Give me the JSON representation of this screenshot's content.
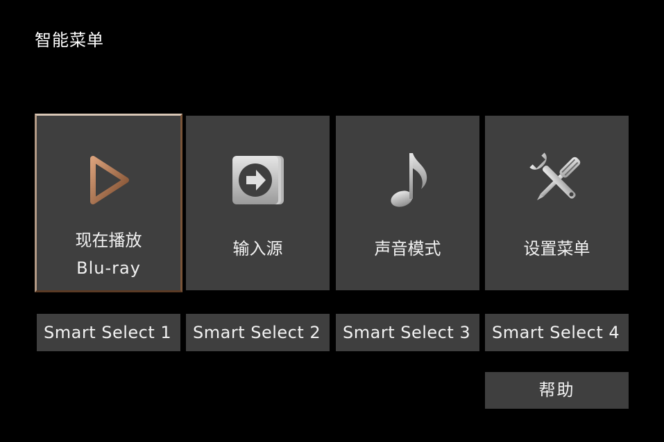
{
  "menu": {
    "title": "智能菜单"
  },
  "tiles": [
    {
      "label": "现在播放",
      "sublabel": "Blu-ray",
      "icon": "play-icon",
      "selected": true
    },
    {
      "label": "输入源",
      "icon": "input-source-icon",
      "selected": false
    },
    {
      "label": "声音模式",
      "icon": "music-note-icon",
      "selected": false
    },
    {
      "label": "设置菜单",
      "icon": "tools-icon",
      "selected": false
    }
  ],
  "smart_select": [
    {
      "label": "Smart Select 1"
    },
    {
      "label": "Smart Select 2"
    },
    {
      "label": "Smart Select 3"
    },
    {
      "label": "Smart Select 4"
    }
  ],
  "help": {
    "label": "帮助"
  },
  "colors": {
    "background": "#000000",
    "tile": "#3f3f3f",
    "text": "#f2f2f2",
    "selection_border": "#b08a6a"
  }
}
